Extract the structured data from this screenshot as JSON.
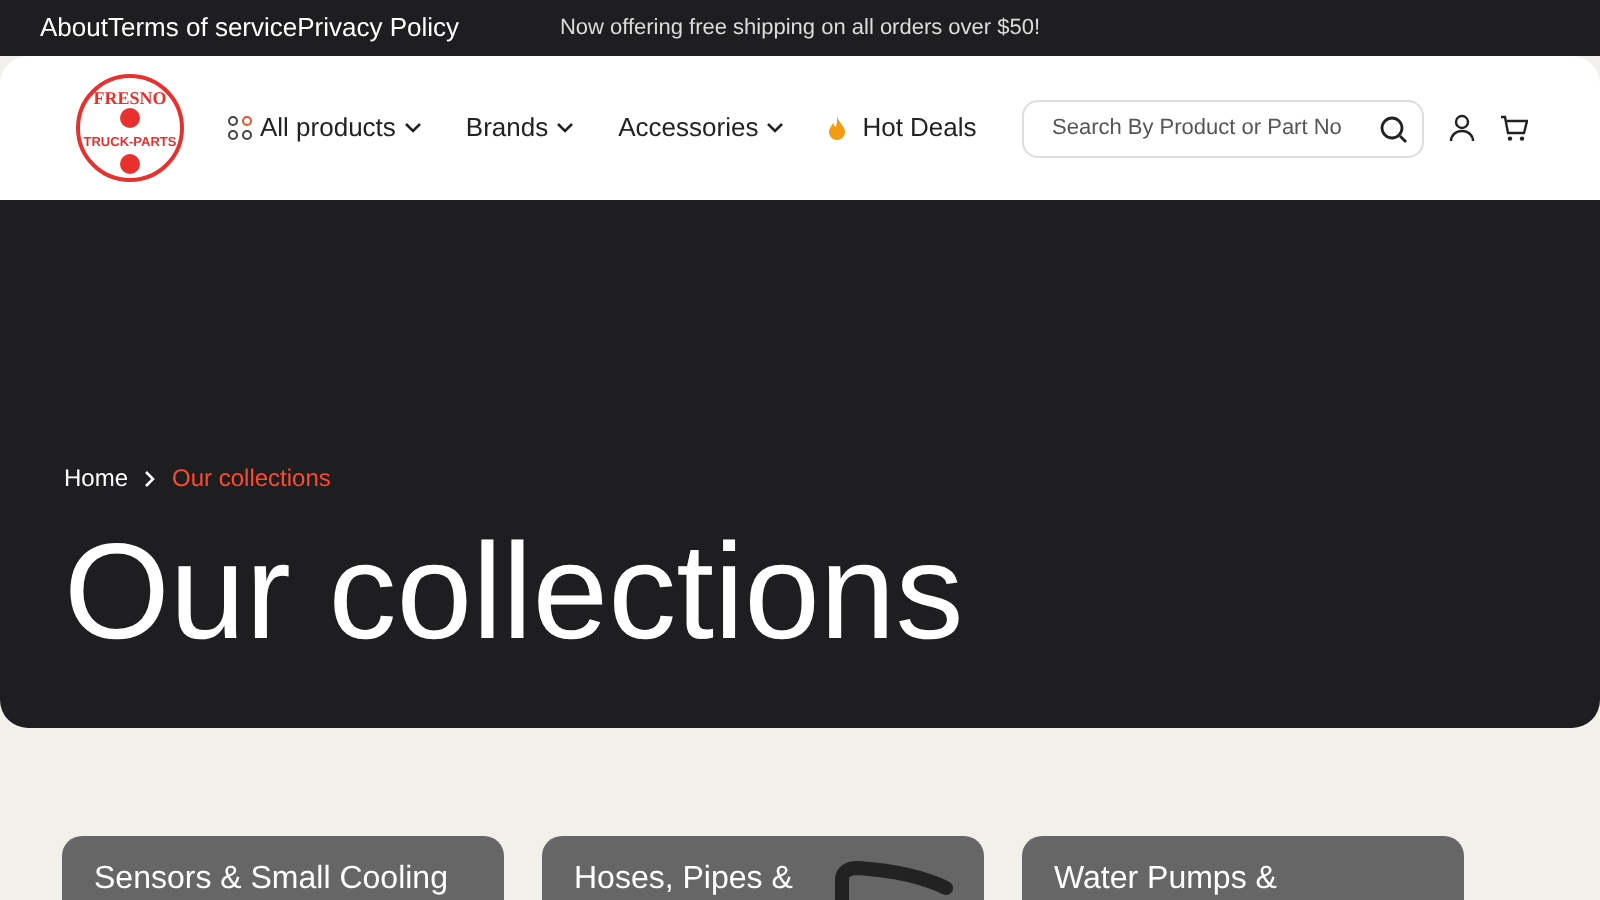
{
  "top_bar": {
    "links": [
      "About",
      "Terms of service",
      "Privacy Policy"
    ],
    "announcement": "Now offering free shipping on all orders over $50!"
  },
  "header": {
    "logo": {
      "top_text": "FRESNO",
      "bottom_text": "TRUCK-PARTS"
    },
    "nav": [
      {
        "label": "All products",
        "kind": "grid",
        "dropdown": true
      },
      {
        "label": "Brands",
        "kind": "plain",
        "dropdown": true
      },
      {
        "label": "Accessories",
        "kind": "plain",
        "dropdown": true
      },
      {
        "label": "Hot Deals",
        "kind": "flame",
        "dropdown": false
      }
    ],
    "search": {
      "placeholder": "Search By Product or Part No"
    }
  },
  "hero": {
    "breadcrumb": [
      {
        "label": "Home",
        "selected": false
      },
      {
        "label": "Our collections",
        "selected": true
      }
    ],
    "title": "Our collections"
  },
  "collections": [
    {
      "title": "Sensors & Small Cooling",
      "has_image": false
    },
    {
      "title": "Hoses, Pipes &",
      "has_image": true
    },
    {
      "title": "Water Pumps &",
      "has_image": false
    }
  ]
}
